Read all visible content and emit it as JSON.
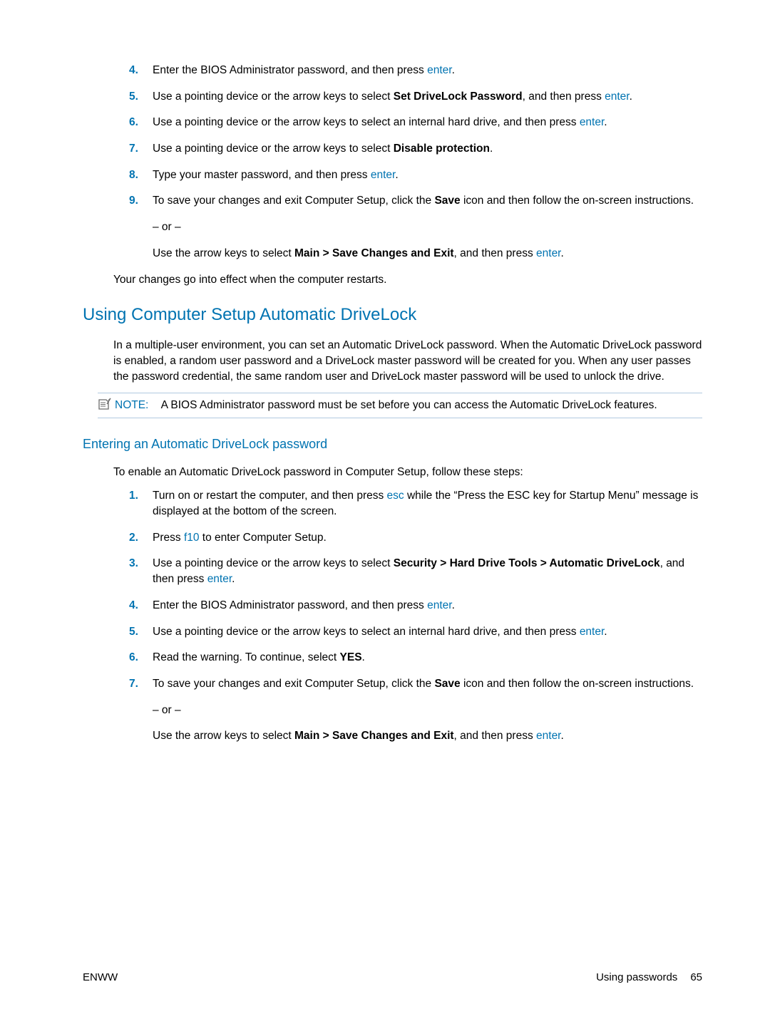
{
  "top_list": {
    "start": 4,
    "items": [
      {
        "parts": [
          {
            "t": "Enter the BIOS Administrator password, and then press "
          },
          {
            "t": "enter",
            "cls": "key"
          },
          {
            "t": "."
          }
        ]
      },
      {
        "parts": [
          {
            "t": "Use a pointing device or the arrow keys to select "
          },
          {
            "t": "Set DriveLock Password",
            "cls": "strong"
          },
          {
            "t": ", and then press "
          },
          {
            "t": "enter",
            "cls": "key"
          },
          {
            "t": "."
          }
        ]
      },
      {
        "parts": [
          {
            "t": "Use a pointing device or the arrow keys to select an internal hard drive, and then press "
          },
          {
            "t": "enter",
            "cls": "key"
          },
          {
            "t": "."
          }
        ]
      },
      {
        "parts": [
          {
            "t": "Use a pointing device or the arrow keys to select "
          },
          {
            "t": "Disable protection",
            "cls": "strong"
          },
          {
            "t": "."
          }
        ]
      },
      {
        "parts": [
          {
            "t": "Type your master password, and then press "
          },
          {
            "t": "enter",
            "cls": "key"
          },
          {
            "t": "."
          }
        ]
      },
      {
        "parts": [
          {
            "t": "To save your changes and exit Computer Setup, click the "
          },
          {
            "t": "Save",
            "cls": "strong"
          },
          {
            "t": " icon and then follow the on-screen instructions."
          }
        ],
        "subs": [
          [
            {
              "t": "– or –"
            }
          ],
          [
            {
              "t": "Use the arrow keys to select "
            },
            {
              "t": "Main > Save Changes and Exit",
              "cls": "strong"
            },
            {
              "t": ", and then press "
            },
            {
              "t": "enter",
              "cls": "key"
            },
            {
              "t": "."
            }
          ]
        ]
      }
    ]
  },
  "after_top": "Your changes go into effect when the computer restarts.",
  "h2": "Using Computer Setup Automatic DriveLock",
  "section_body": "In a multiple-user environment, you can set an Automatic DriveLock password. When the Automatic DriveLock password is enabled, a random user password and a DriveLock master password will be created for you. When any user passes the password credential, the same random user and DriveLock master password will be used to unlock the drive.",
  "note_label": "NOTE:",
  "note_text": "A BIOS Administrator password must be set before you can access the Automatic DriveLock features.",
  "h3": "Entering an Automatic DriveLock password",
  "h3_intro": "To enable an Automatic DriveLock password in Computer Setup, follow these steps:",
  "bottom_list": {
    "start": 1,
    "items": [
      {
        "parts": [
          {
            "t": "Turn on or restart the computer, and then press "
          },
          {
            "t": "esc",
            "cls": "key"
          },
          {
            "t": " while the “Press the ESC key for Startup Menu” message is displayed at the bottom of the screen."
          }
        ]
      },
      {
        "parts": [
          {
            "t": "Press "
          },
          {
            "t": "f10",
            "cls": "key"
          },
          {
            "t": " to enter Computer Setup."
          }
        ]
      },
      {
        "parts": [
          {
            "t": "Use a pointing device or the arrow keys to select "
          },
          {
            "t": "Security > Hard Drive Tools > Automatic DriveLock",
            "cls": "strong"
          },
          {
            "t": ", and then press "
          },
          {
            "t": "enter",
            "cls": "key"
          },
          {
            "t": "."
          }
        ]
      },
      {
        "parts": [
          {
            "t": "Enter the BIOS Administrator password, and then press "
          },
          {
            "t": "enter",
            "cls": "key"
          },
          {
            "t": "."
          }
        ]
      },
      {
        "parts": [
          {
            "t": "Use a pointing device or the arrow keys to select an internal hard drive, and then press "
          },
          {
            "t": "enter",
            "cls": "key"
          },
          {
            "t": "."
          }
        ]
      },
      {
        "parts": [
          {
            "t": "Read the warning. To continue, select "
          },
          {
            "t": "YES",
            "cls": "strong"
          },
          {
            "t": "."
          }
        ]
      },
      {
        "parts": [
          {
            "t": "To save your changes and exit Computer Setup, click the "
          },
          {
            "t": "Save",
            "cls": "strong"
          },
          {
            "t": " icon and then follow the on-screen instructions."
          }
        ],
        "subs": [
          [
            {
              "t": "– or –"
            }
          ],
          [
            {
              "t": "Use the arrow keys to select "
            },
            {
              "t": "Main > Save Changes and Exit",
              "cls": "strong"
            },
            {
              "t": ", and then press "
            },
            {
              "t": "enter",
              "cls": "key"
            },
            {
              "t": "."
            }
          ]
        ]
      }
    ]
  },
  "footer": {
    "left": "ENWW",
    "right_label": "Using passwords",
    "page": "65"
  }
}
